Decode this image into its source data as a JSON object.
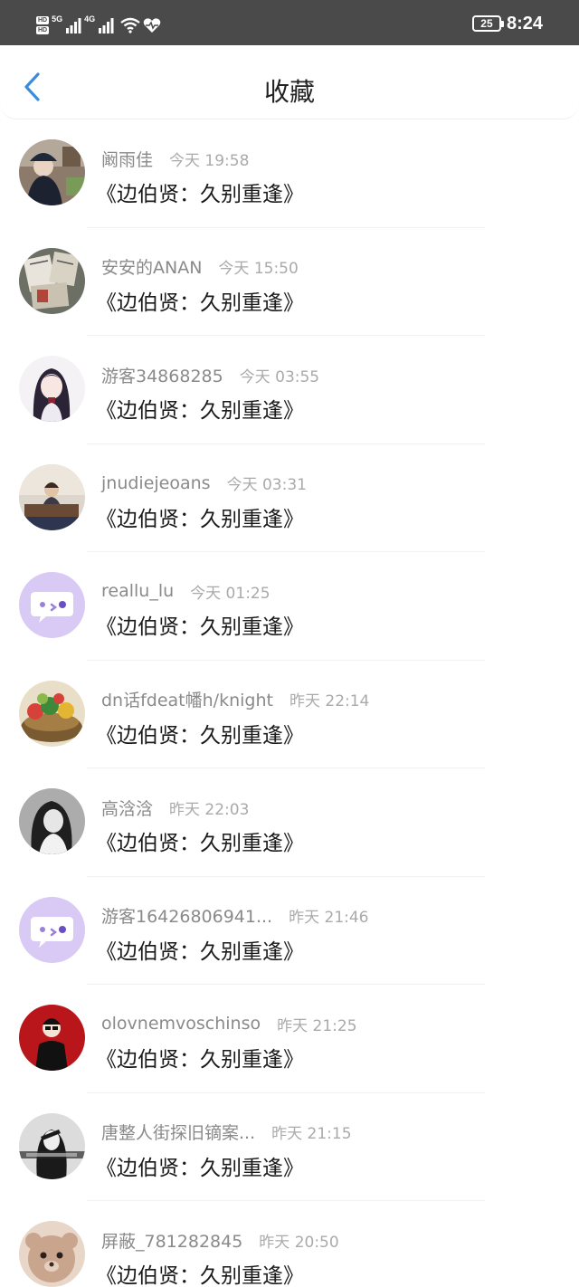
{
  "status_bar": {
    "hd_top": "HD",
    "hd_bottom": "HD",
    "network_1": "5G",
    "network_2": "4G",
    "battery": "25",
    "time": "8:24",
    "icons": [
      "signal-icon",
      "wifi-icon",
      "heart-rate-icon"
    ]
  },
  "header": {
    "title": "收藏",
    "back_icon": "chevron-left-icon",
    "accent_color": "#3b8ddc"
  },
  "favorites": [
    {
      "name": "阚雨佳",
      "time": "今天 19:58",
      "subject": "《边伯贤：久别重逢》",
      "avatar": "photo-girl-hat"
    },
    {
      "name": "安安的ANAN",
      "time": "今天 15:50",
      "subject": "《边伯贤：久别重逢》",
      "avatar": "photo-newspapers"
    },
    {
      "name": "游客34868285",
      "time": "今天 03:55",
      "subject": "《边伯贤：久别重逢》",
      "avatar": "anime-girl"
    },
    {
      "name": "jnudiejeoans",
      "time": "今天 03:31",
      "subject": "《边伯贤：久别重逢》",
      "avatar": "photo-man-desk"
    },
    {
      "name": "reallu_lu",
      "time": "今天 01:25",
      "subject": "《边伯贤：久别重逢》",
      "avatar": "default-chat-bubble"
    },
    {
      "name": "dn话fdeat幡h/knight",
      "time": "昨天 22:14",
      "subject": "《边伯贤：久别重逢》",
      "avatar": "photo-fruit-basket"
    },
    {
      "name": "高浛浛",
      "time": "昨天 22:03",
      "subject": "《边伯贤：久别重逢》",
      "avatar": "photo-bw-girl"
    },
    {
      "name": "游客16426806941...",
      "time": "昨天 21:46",
      "subject": "《边伯贤：久别重逢》",
      "avatar": "default-chat-bubble"
    },
    {
      "name": "olovnemvoschinso",
      "time": "昨天 21:25",
      "subject": "《边伯贤：久别重逢》",
      "avatar": "cartoon-man-red"
    },
    {
      "name": "唐整人街探旧镝案...",
      "time": "昨天 21:15",
      "subject": "《边伯贤：久别重逢》",
      "avatar": "photo-bw-girl-text"
    },
    {
      "name": "屏蔽_781282845",
      "time": "昨天 20:50",
      "subject": "《边伯贤：久别重逢》",
      "avatar": "photo-teddy-bear"
    }
  ]
}
